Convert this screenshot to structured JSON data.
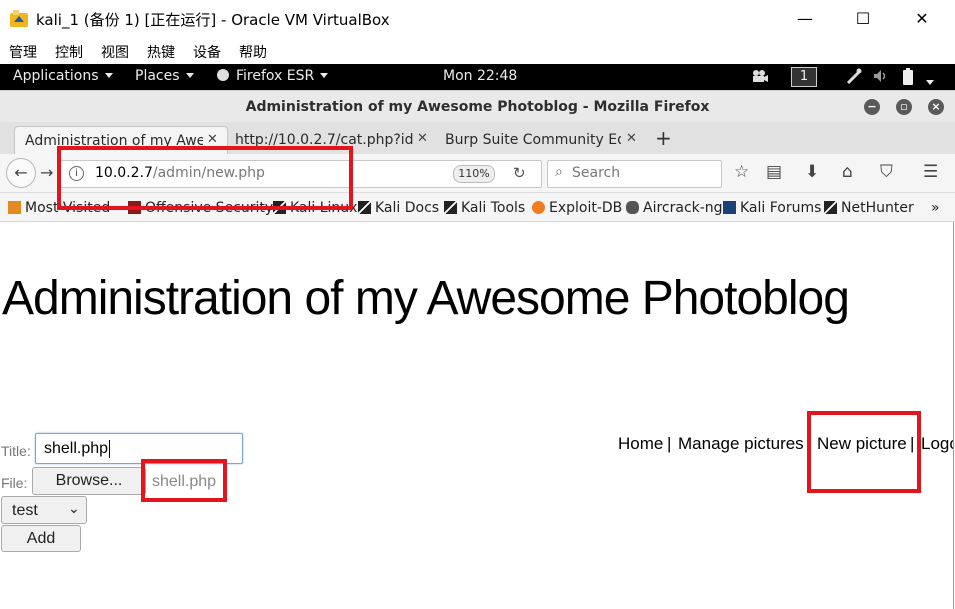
{
  "vbox": {
    "title": "kali_1 (备份 1) [正在运行] - Oracle VM VirtualBox",
    "menu": [
      "管理",
      "控制",
      "视图",
      "热键",
      "设备",
      "帮助"
    ],
    "minimize": "—",
    "maximize": "☐",
    "close": "✕"
  },
  "panel": {
    "applications": "Applications",
    "places": "Places",
    "firefox_esr": "Firefox ESR",
    "clock": "Mon 22:48",
    "workspace": "1"
  },
  "firefox": {
    "window_title": "Administration of my Awesome Photoblog - Mozilla Firefox",
    "tabs": [
      {
        "label": "Administration of my Awe..."
      },
      {
        "label": "http://10.0.2.7/cat.php?id..."
      },
      {
        "label": "Burp Suite Community Ed..."
      }
    ],
    "new_tab": "+",
    "url": {
      "host": "10.0.2.7",
      "path": "/admin/new.php"
    },
    "zoom": "110%",
    "search_placeholder": "Search",
    "bookmarks": [
      "Most Visited",
      "Offensive Security",
      "Kali Linux",
      "Kali Docs",
      "Kali Tools",
      "Exploit-DB",
      "Aircrack-ng",
      "Kali Forums",
      "NetHunter"
    ],
    "bookmarks_overflow": "»"
  },
  "page": {
    "heading": "Administration of my Awesome Photoblog",
    "nav": [
      "Home",
      "Manage pictures",
      "New picture",
      "Logout"
    ],
    "separator": "|",
    "title_label": "Title:",
    "title_value": "shell.php",
    "file_label": "File:",
    "browse_label": "Browse...",
    "file_name": "shell.php",
    "category_value": "test",
    "add_label": "Add"
  },
  "colors": {
    "highlight_border": "#e3141c",
    "panel_bg": "#000000"
  }
}
